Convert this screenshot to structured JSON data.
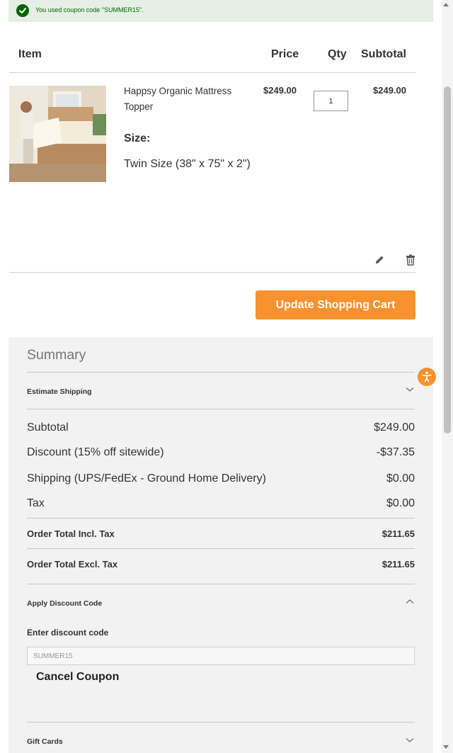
{
  "message": {
    "text": "You used coupon code \"SUMMER15\".",
    "icon": "check-circle-icon",
    "color": "#006400",
    "background": "#e5efe5"
  },
  "cart": {
    "headers": {
      "item": "Item",
      "price": "Price",
      "qty": "Qty",
      "subtotal": "Subtotal"
    },
    "item": {
      "name": "Happsy Organic Mattress Topper",
      "option_label": "Size:",
      "option_value": "Twin Size (38\" x 75\" x 2\")",
      "price": "$249.00",
      "qty": "1",
      "subtotal": "$249.00",
      "edit_icon": "pencil-icon",
      "delete_icon": "trash-icon"
    },
    "update_button": "Update Shopping Cart"
  },
  "summary": {
    "title": "Summary",
    "estimate_shipping": "Estimate Shipping",
    "subtotal_label": "Subtotal",
    "subtotal_value": "$249.00",
    "discount_label": "Discount (15% off sitewide)",
    "discount_value": "-$37.35",
    "shipping_label": "Shipping (UPS/FedEx - Ground Home Delivery)",
    "shipping_value": "$0.00",
    "tax_label": "Tax",
    "tax_value": "$0.00",
    "total_incl_label": "Order Total Incl. Tax",
    "total_incl_value": "$211.65",
    "total_excl_label": "Order Total Excl. Tax",
    "total_excl_value": "$211.65",
    "discount_section_title": "Apply Discount Code",
    "discount_field_label": "Enter discount code",
    "discount_field_value": "SUMMER15",
    "cancel_coupon": "Cancel Coupon",
    "gift_cards": "Gift Cards"
  },
  "colors": {
    "accent": "#f7922e",
    "panel": "#f2f2f2",
    "text": "#333333"
  }
}
